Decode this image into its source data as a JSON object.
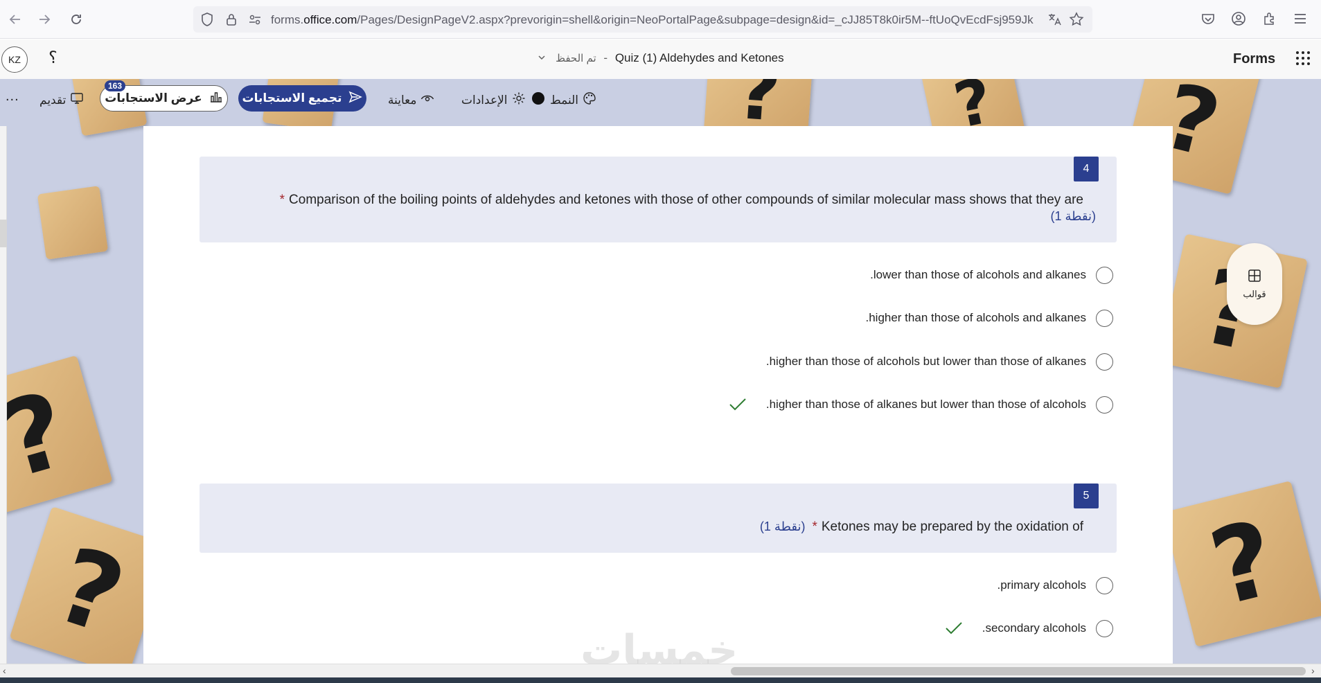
{
  "browser": {
    "url_prefix": "forms.",
    "url_domain": "office.com",
    "url_rest": "/Pages/DesignPageV2.aspx?prevorigin=shell&origin=NeoPortalPage&subpage=design&id=_cJJ85T8k0ir5M--ftUoQvEcdFsj959Jk"
  },
  "header": {
    "app_name": "Forms",
    "form_title": "Quiz (1) Aldehydes and Ketones",
    "separator": "-",
    "save_status": "تم الحفظ",
    "avatar_initials": "KZ",
    "help_label": "؟"
  },
  "commands": {
    "theme": "النمط",
    "settings": "الإعدادات",
    "preview": "معاينة",
    "collect": "تجميع الاستجابات",
    "view_responses": "عرض الاستجابات",
    "response_count": "163",
    "present": "تقديم",
    "more": "..."
  },
  "templates_label": "قوالب",
  "questions": [
    {
      "number": "4",
      "text": "Comparison of the boiling points of aldehydes and ketones with those of other compounds of similar molecular mass shows that they are",
      "required_mark": "*",
      "points": "(1 نقطة)",
      "options": [
        {
          "text": ".lower than those of alcohols and alkanes",
          "correct": false
        },
        {
          "text": ".higher than those of alcohols and alkanes",
          "correct": false
        },
        {
          "text": ".higher than those of alcohols but lower than those of alkanes",
          "correct": false
        },
        {
          "text": ".higher than those of alkanes but lower than those of alcohols",
          "correct": true
        }
      ]
    },
    {
      "number": "5",
      "text": "Ketones may be prepared by the oxidation of",
      "required_mark": "*",
      "points": "(1 نقطة)",
      "options": [
        {
          "text": ".primary alcohols",
          "correct": false
        },
        {
          "text": ".secondary alcohols",
          "correct": true
        }
      ]
    }
  ],
  "watermark": "خمسات",
  "colors": {
    "accent": "#2b3f8f",
    "correct_check": "#2e7d32",
    "required": "#a4262c"
  }
}
